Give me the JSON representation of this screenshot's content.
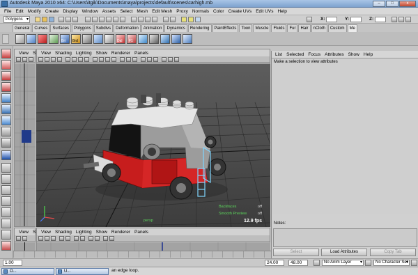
{
  "window": {
    "title": "Autodesk Maya 2010 x64: C:\\Users\\itgik\\Documents\\maya\\projects\\default\\scenes\\carhigh.mb",
    "controls": [
      "minimize-icon",
      "maximize-icon",
      "close-icon"
    ],
    "minimize_glyph": "–",
    "maximize_glyph": "□",
    "close_glyph": "x"
  },
  "menubar": [
    "File",
    "Edit",
    "Modify",
    "Create",
    "Display",
    "Window",
    "Assets",
    "Select",
    "Mesh",
    "Edit Mesh",
    "Proxy",
    "Normals",
    "Color",
    "Create UVs",
    "Edit UVs",
    "Help"
  ],
  "statusline": {
    "mode": "Polygons",
    "x_label": "X:",
    "y_label": "Y:",
    "z_label": "Z:"
  },
  "shelf_tabs": [
    "General",
    "Curves",
    "Surfaces",
    "Polygons",
    "Subdivs",
    "Deformation",
    "Animation",
    "Dynamics",
    "Rendering",
    "PaintEffects",
    "Toon",
    "Muscle",
    "Fluids",
    "Fur",
    "Hair",
    "nCloth",
    "Custom",
    "Me"
  ],
  "shelf_active": "Me",
  "shelf_labels": [
    "Bri",
    "Brd",
    "Dal",
    "F1"
  ],
  "left_panel": {
    "menu": [
      "View",
      "Sh"
    ]
  },
  "persp_panel": {
    "menu": [
      "View",
      "Shading",
      "Lighting",
      "Show",
      "Renderer",
      "Panels"
    ],
    "hud": {
      "row1_label": "Backfaces",
      "row1_value": "off",
      "row2_label": "Smooth Preview",
      "row2_value": "off",
      "camera": "persp",
      "fps": "12.9 fps"
    }
  },
  "bottom_panels": {
    "left_menu": [
      "View",
      "Sh"
    ],
    "main_menu": [
      "View",
      "Shading",
      "Lighting",
      "Show",
      "Renderer",
      "Panels"
    ]
  },
  "attribute_editor": {
    "menu": [
      "List",
      "Selected",
      "Focus",
      "Attributes",
      "Show",
      "Help"
    ],
    "hint": "Make a selection to view attributes",
    "notes_label": "Notes:",
    "buttons": {
      "select": "Select",
      "load": "Load Attributes",
      "copy": "Copy Tab"
    }
  },
  "range": {
    "start": "1.00",
    "end": "24.00",
    "max": "48.00",
    "anim_layer": "No Anim Layer",
    "character_set": "No Character Set"
  },
  "helpline": {
    "text": "an edge loop.",
    "tasks": [
      "O...",
      "U..."
    ]
  },
  "colors": {
    "car_red": "#d01f1f",
    "car_gray": "#a8a8a8",
    "car_white": "#e4e4e4",
    "car_black": "#151515",
    "highlight_cyan": "#7fd6ff",
    "hud_green": "#5cd65c"
  }
}
